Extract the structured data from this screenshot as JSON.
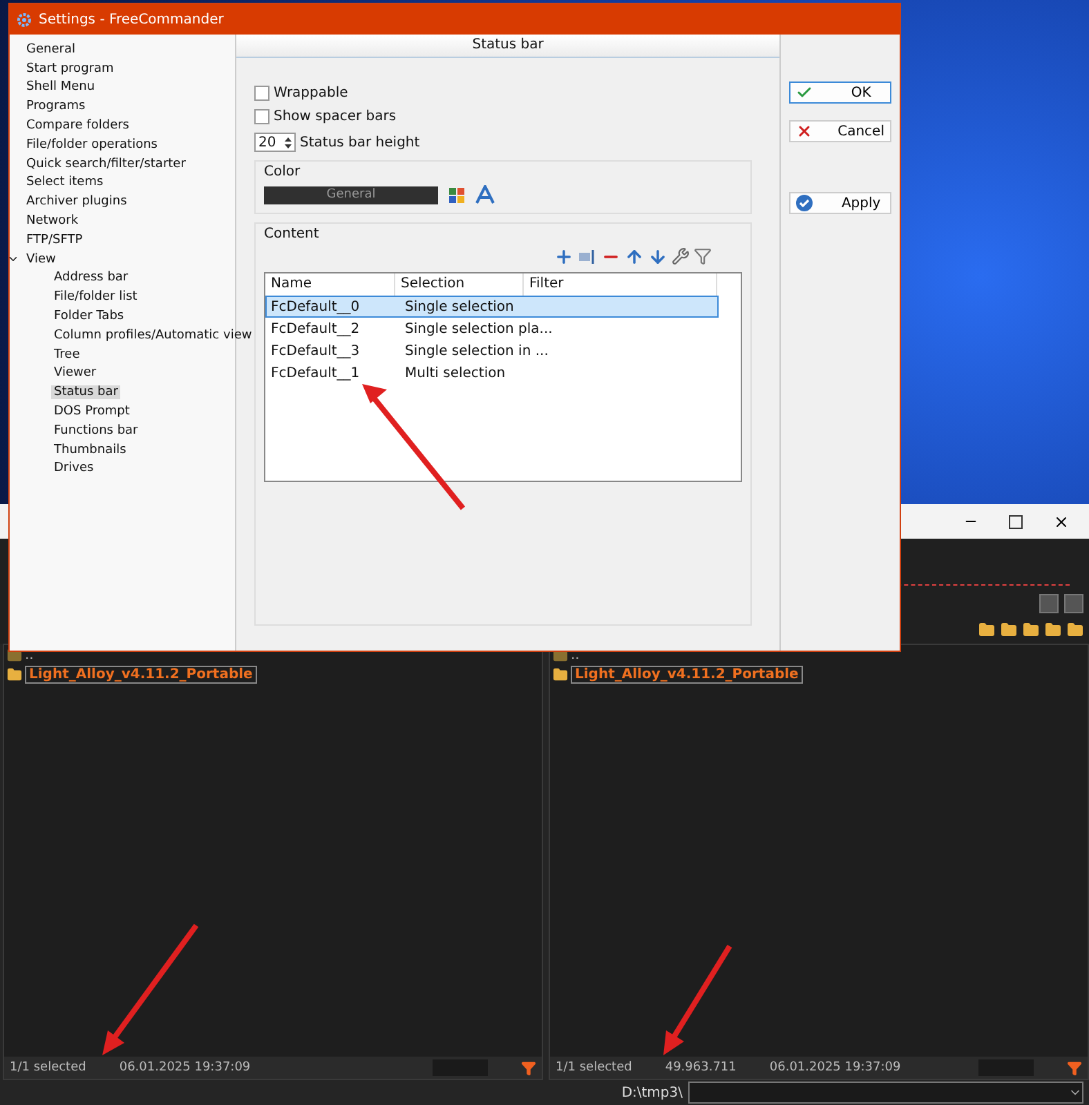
{
  "dialog": {
    "title": "Settings - FreeCommander",
    "tree": [
      {
        "label": "General",
        "selected": false
      },
      {
        "label": "Start program",
        "selected": false
      },
      {
        "label": "Shell Menu",
        "selected": false
      },
      {
        "label": "Programs",
        "selected": false
      },
      {
        "label": "Compare folders",
        "selected": false
      },
      {
        "label": "File/folder operations",
        "selected": false
      },
      {
        "label": "Quick search/filter/starter",
        "selected": false
      },
      {
        "label": "Select items",
        "selected": false
      },
      {
        "label": "Archiver plugins",
        "selected": false
      },
      {
        "label": "Network",
        "selected": false
      },
      {
        "label": "FTP/SFTP",
        "selected": false
      },
      {
        "label": "View",
        "selected": false,
        "expanded": true,
        "children": [
          {
            "label": "Address bar",
            "selected": false
          },
          {
            "label": "File/folder list",
            "selected": false
          },
          {
            "label": "Folder Tabs",
            "selected": false
          },
          {
            "label": "Column profiles/Automatic view",
            "selected": false
          },
          {
            "label": "Tree",
            "selected": false
          },
          {
            "label": "Viewer",
            "selected": false
          },
          {
            "label": "Status bar",
            "selected": true
          },
          {
            "label": "DOS Prompt",
            "selected": false
          },
          {
            "label": "Functions bar",
            "selected": false
          },
          {
            "label": "Thumbnails",
            "selected": false
          },
          {
            "label": "Drives",
            "selected": false
          }
        ]
      }
    ],
    "page_title": "Status bar",
    "options": [
      {
        "label": "Wrappable",
        "checked": false
      },
      {
        "label": "Show spacer bars",
        "checked": false
      }
    ],
    "height": {
      "value": "20",
      "label": "Status bar height"
    },
    "color_group": {
      "title": "Color",
      "swatch": "General"
    },
    "content": {
      "title": "Content",
      "columns": [
        "Name",
        "Selection",
        "Filter"
      ],
      "rows": [
        {
          "name": "FcDefault__0",
          "selection": "Single selection",
          "selected": true
        },
        {
          "name": "FcDefault__2",
          "selection": "Single selection pla...",
          "selected": false
        },
        {
          "name": "FcDefault__3",
          "selection": "Single selection in ...",
          "selected": false
        },
        {
          "name": "FcDefault__1",
          "selection": "Multi selection",
          "selected": false
        }
      ]
    },
    "buttons": [
      {
        "label": "OK",
        "kind": "ok",
        "default": true
      },
      {
        "label": "Cancel",
        "kind": "cancel",
        "default": false
      },
      {
        "label": "Apply",
        "kind": "apply",
        "default": false
      }
    ]
  },
  "main": {
    "panels": [
      {
        "parent": "..",
        "items": [
          {
            "name": "Light_Alloy_v4.11.2_Portable",
            "selected": true
          }
        ],
        "status": [
          "1/1 selected",
          "06.01.2025 19:37:09"
        ]
      },
      {
        "parent": "..",
        "items": [
          {
            "name": "Light_Alloy_v4.11.2_Portable",
            "selected": true
          }
        ],
        "status": [
          "1/1 selected",
          "49.963.711",
          "06.01.2025 19:37:09"
        ]
      }
    ],
    "path": "D:\\tmp3\\"
  }
}
